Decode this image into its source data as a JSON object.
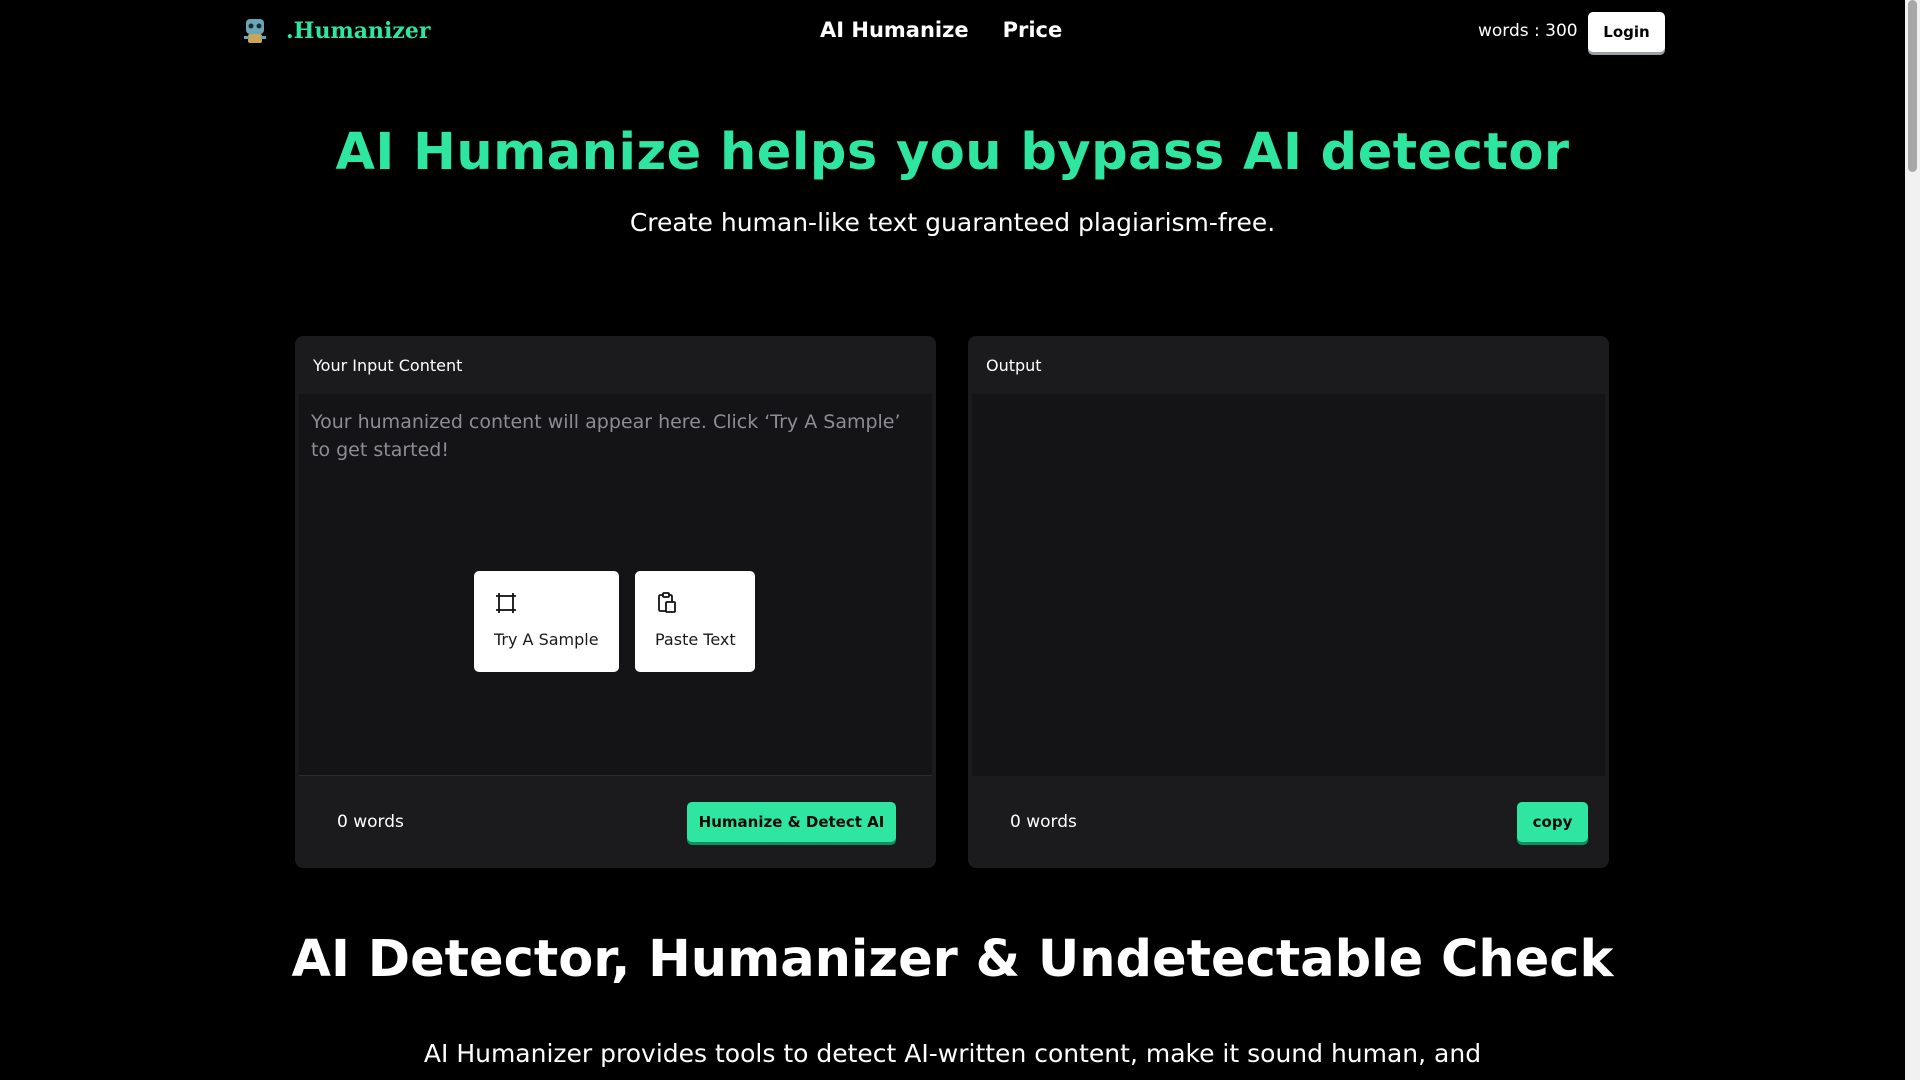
{
  "header": {
    "logo_text": ".Humanizer",
    "nav": [
      {
        "label": "AI Humanize"
      },
      {
        "label": "Price"
      }
    ],
    "words_label": "words : 300",
    "login_label": "Login"
  },
  "hero": {
    "title": "AI Humanize helps you bypass AI detector",
    "subtitle": "Create human-like text guaranteed plagiarism-free."
  },
  "input_panel": {
    "title": "Your Input Content",
    "placeholder": "Your humanized content will appear here. Click ‘Try A Sample’ to get started!",
    "try_sample_label": "Try A Sample",
    "paste_text_label": "Paste Text",
    "word_count": "0 words",
    "humanize_button": "Humanize & Detect AI"
  },
  "output_panel": {
    "title": "Output",
    "word_count": "0 words",
    "copy_button": "copy"
  },
  "section": {
    "title": "AI Detector, Humanizer & Undetectable Check",
    "description": "AI Humanizer provides tools to detect AI-written content, make it sound human, and"
  },
  "colors": {
    "accent": "#2ee6a0",
    "panel_bg": "#1b1b1e",
    "page_bg": "#000000"
  },
  "icons": {
    "logo": "robot-logo-icon",
    "try_sample": "frame-select-icon",
    "paste_text": "clipboard-paste-icon"
  }
}
